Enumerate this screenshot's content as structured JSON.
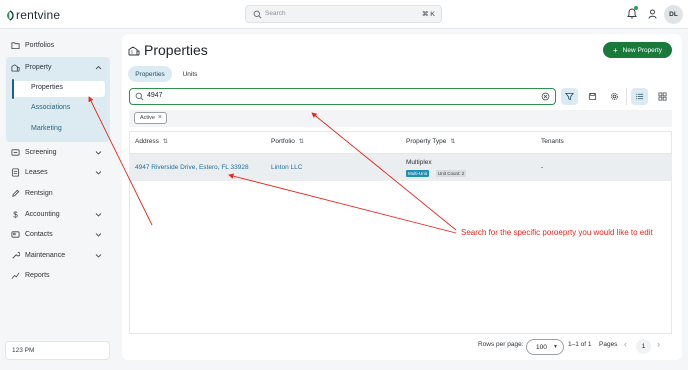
{
  "app": {
    "brand": "rentvine"
  },
  "topbar": {
    "search_placeholder": "Search",
    "search_shortcut": "⌘ K",
    "avatar_initials": "DL"
  },
  "sidebar": {
    "items": [
      {
        "label": "Portfolios",
        "icon": "folder-icon"
      },
      {
        "label": "Property",
        "icon": "building-icon",
        "expanded": true
      },
      {
        "label": "Screening",
        "icon": "screening-icon"
      },
      {
        "label": "Leases",
        "icon": "lease-icon"
      },
      {
        "label": "Rentsign",
        "icon": "pen-icon"
      },
      {
        "label": "Accounting",
        "icon": "dollar-icon"
      },
      {
        "label": "Contacts",
        "icon": "contacts-icon"
      },
      {
        "label": "Maintenance",
        "icon": "wrench-icon"
      },
      {
        "label": "Reports",
        "icon": "chart-icon"
      }
    ],
    "property_subitems": [
      {
        "label": "Properties",
        "active": true
      },
      {
        "label": "Associations"
      },
      {
        "label": "Marketing"
      }
    ],
    "footer_text": "123 PM"
  },
  "page": {
    "title": "Properties",
    "new_button": "New Property",
    "tabs": [
      {
        "label": "Properties",
        "active": true
      },
      {
        "label": "Units"
      }
    ],
    "search_value": "4947",
    "filter_chip": "Active"
  },
  "table": {
    "columns": [
      "Address",
      "Portfolio",
      "Property Type",
      "Tenants"
    ],
    "rows": [
      {
        "address": "4947 Riverside Drive, Estero, FL 33928",
        "portfolio": "Linton LLC",
        "type": "Multiplex",
        "badge_primary": "Multi-Unit",
        "badge_secondary": "Unit Count: 2",
        "tenants": "-"
      }
    ]
  },
  "pagination": {
    "rows_label": "Rows per page:",
    "rows_value": "100",
    "range": "1–1 of 1",
    "pages_label": "Pages",
    "current_page": "1"
  },
  "annotation": {
    "text": "Search for the specific poroeprty you would like to edit",
    "color": "#e8271c"
  },
  "colors": {
    "accent": "#1a7a3c",
    "link": "#1f6d9a",
    "selected": "#dcebf2"
  }
}
